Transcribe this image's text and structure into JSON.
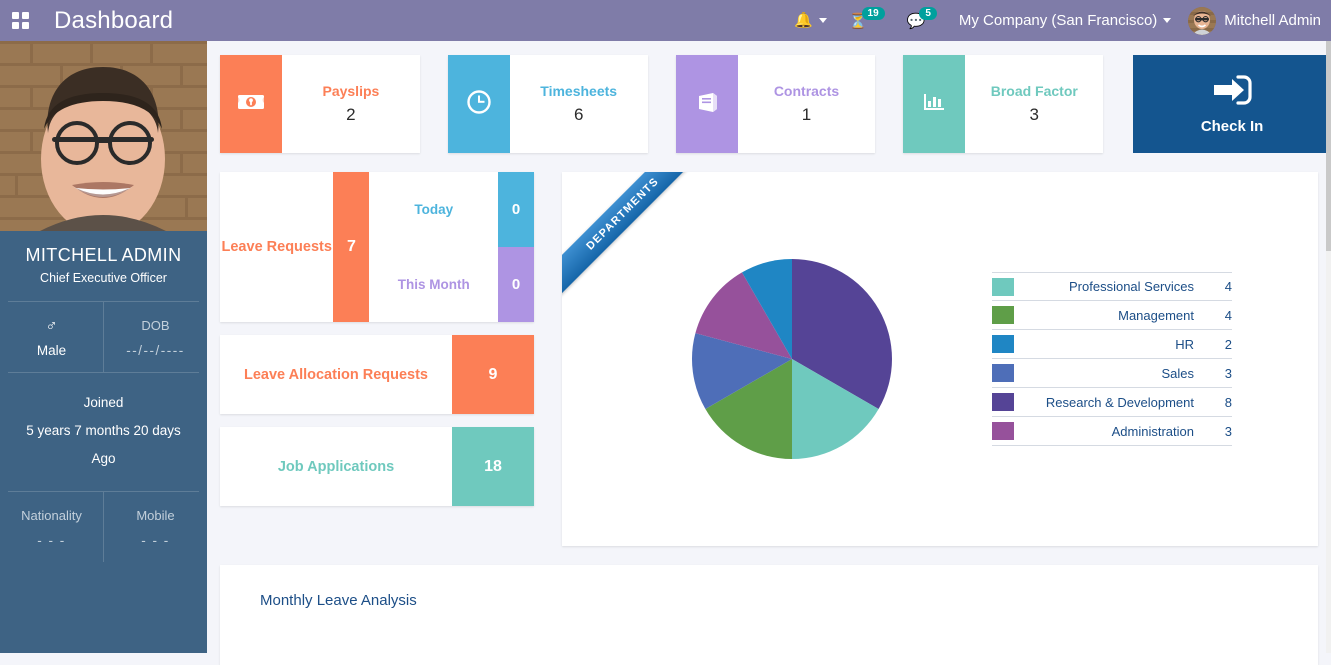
{
  "topbar": {
    "apps_icon": "apps-grid-icon",
    "title": "Dashboard",
    "bell_icon": "bell-icon",
    "activity_icon": "clock-activity-icon",
    "activity_count": "19",
    "messages_icon": "chat-bubble-icon",
    "messages_count": "5",
    "company": "My Company (San Francisco)",
    "user_name": "Mitchell Admin"
  },
  "profile": {
    "photo_alt": "employee-photo",
    "name": "MITCHELL ADMIN",
    "job_title": "Chief Executive Officer",
    "gender_symbol": "♂",
    "gender_label": "Male",
    "dob_label": "DOB",
    "dob_value": "--/--/----",
    "joined_label": "Joined",
    "joined_value": "5 years 7 months 20 days",
    "joined_suffix": "Ago",
    "nationality_label": "Nationality",
    "nationality_value": "- - -",
    "mobile_label": "Mobile",
    "mobile_value": "- - -"
  },
  "kpis": [
    {
      "label": "Payslips",
      "value": "2",
      "color": "#fc7f56",
      "icon": "money-bill-icon"
    },
    {
      "label": "Timesheets",
      "value": "6",
      "color": "#4db4dd",
      "icon": "clock-icon"
    },
    {
      "label": "Contracts",
      "value": "1",
      "color": "#ae94e3",
      "icon": "book-icon"
    },
    {
      "label": "Broad Factor",
      "value": "3",
      "color": "#6fc9be",
      "icon": "bar-chart-icon"
    }
  ],
  "checkin": {
    "label": "Check In",
    "icon": "sign-in-arrow-icon",
    "color": "#14558f"
  },
  "leave_card": {
    "label": "Leave Requests",
    "count": "7",
    "color": "#fc7f56",
    "today_label": "Today",
    "today_count": "0",
    "today_color": "#4db4dd",
    "month_label": "This Month",
    "month_count": "0",
    "month_color": "#ae94e3"
  },
  "wide_cards": [
    {
      "label": "Leave Allocation Requests",
      "count": "9",
      "color": "#fc7f56"
    },
    {
      "label": "Job Applications",
      "count": "18",
      "color": "#6fc9be"
    }
  ],
  "departments": {
    "ribbon_label": "DEPARTMENTS"
  },
  "bottom": {
    "title": "Monthly Leave Analysis"
  },
  "chart_data": {
    "type": "pie",
    "title": "DEPARTMENTS",
    "categories": [
      "Professional Services",
      "Management",
      "HR",
      "Sales",
      "Research & Development",
      "Administration"
    ],
    "values": [
      4,
      4,
      2,
      3,
      8,
      3
    ],
    "colors": [
      "#6fc9be",
      "#5f9e48",
      "#1f86c4",
      "#4e6eb8",
      "#554496",
      "#96519b"
    ],
    "total": 24,
    "legend_position": "right",
    "start_angle_deg": 0,
    "direction": "clockwise",
    "slice_order_from_top_clockwise": [
      "Research & Development",
      "Professional Services",
      "Management",
      "Sales",
      "Administration",
      "HR"
    ]
  }
}
